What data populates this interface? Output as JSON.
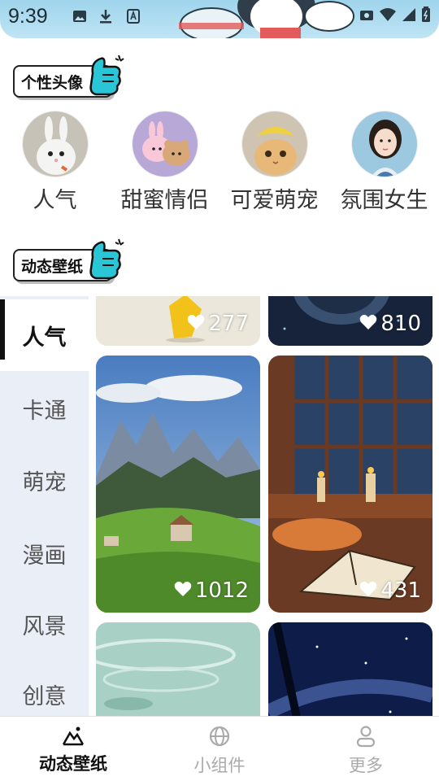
{
  "status_bar": {
    "time": "9:39",
    "left_icons": [
      "image-icon",
      "download-icon",
      "a-box-icon"
    ],
    "right_icons": [
      "camera-icon",
      "wifi-icon",
      "signal-icon",
      "battery-icon"
    ]
  },
  "avatar_section": {
    "badge_text": "个性头像",
    "items": [
      {
        "label": "人气",
        "icon": "bunny-avatar"
      },
      {
        "label": "甜蜜情侣",
        "icon": "couple-cartoon-avatar"
      },
      {
        "label": "可爱萌宠",
        "icon": "cat-avatar"
      },
      {
        "label": "氛围女生",
        "icon": "girl-avatar"
      }
    ]
  },
  "wallpaper_section": {
    "badge_text": "动态壁纸"
  },
  "categories": [
    {
      "label": "人气",
      "active": true
    },
    {
      "label": "卡通",
      "active": false
    },
    {
      "label": "萌宠",
      "active": false
    },
    {
      "label": "漫画",
      "active": false
    },
    {
      "label": "风景",
      "active": false
    },
    {
      "label": "创意",
      "active": false
    }
  ],
  "wallpapers": [
    {
      "likes": "277",
      "theme": "cartoon-figure"
    },
    {
      "likes": "810",
      "theme": "dark-figure"
    },
    {
      "likes": "1012",
      "theme": "mountain-landscape"
    },
    {
      "likes": "431",
      "theme": "cat-candles-book"
    },
    {
      "likes": "",
      "theme": "water-ripple"
    },
    {
      "likes": "",
      "theme": "starry-sky"
    }
  ],
  "bottom_nav": [
    {
      "label": "动态壁纸",
      "icon": "mountain-icon",
      "active": true
    },
    {
      "label": "小组件",
      "icon": "globe-icon",
      "active": false
    },
    {
      "label": "更多",
      "icon": "user-icon",
      "active": false
    }
  ],
  "colors": {
    "status_bar_bg": "#bfe4f4",
    "accent_cyan": "#29c6d8",
    "side_bg": "#e9eef7",
    "text_dark": "#111111",
    "text_muted": "#aaaaaa"
  }
}
